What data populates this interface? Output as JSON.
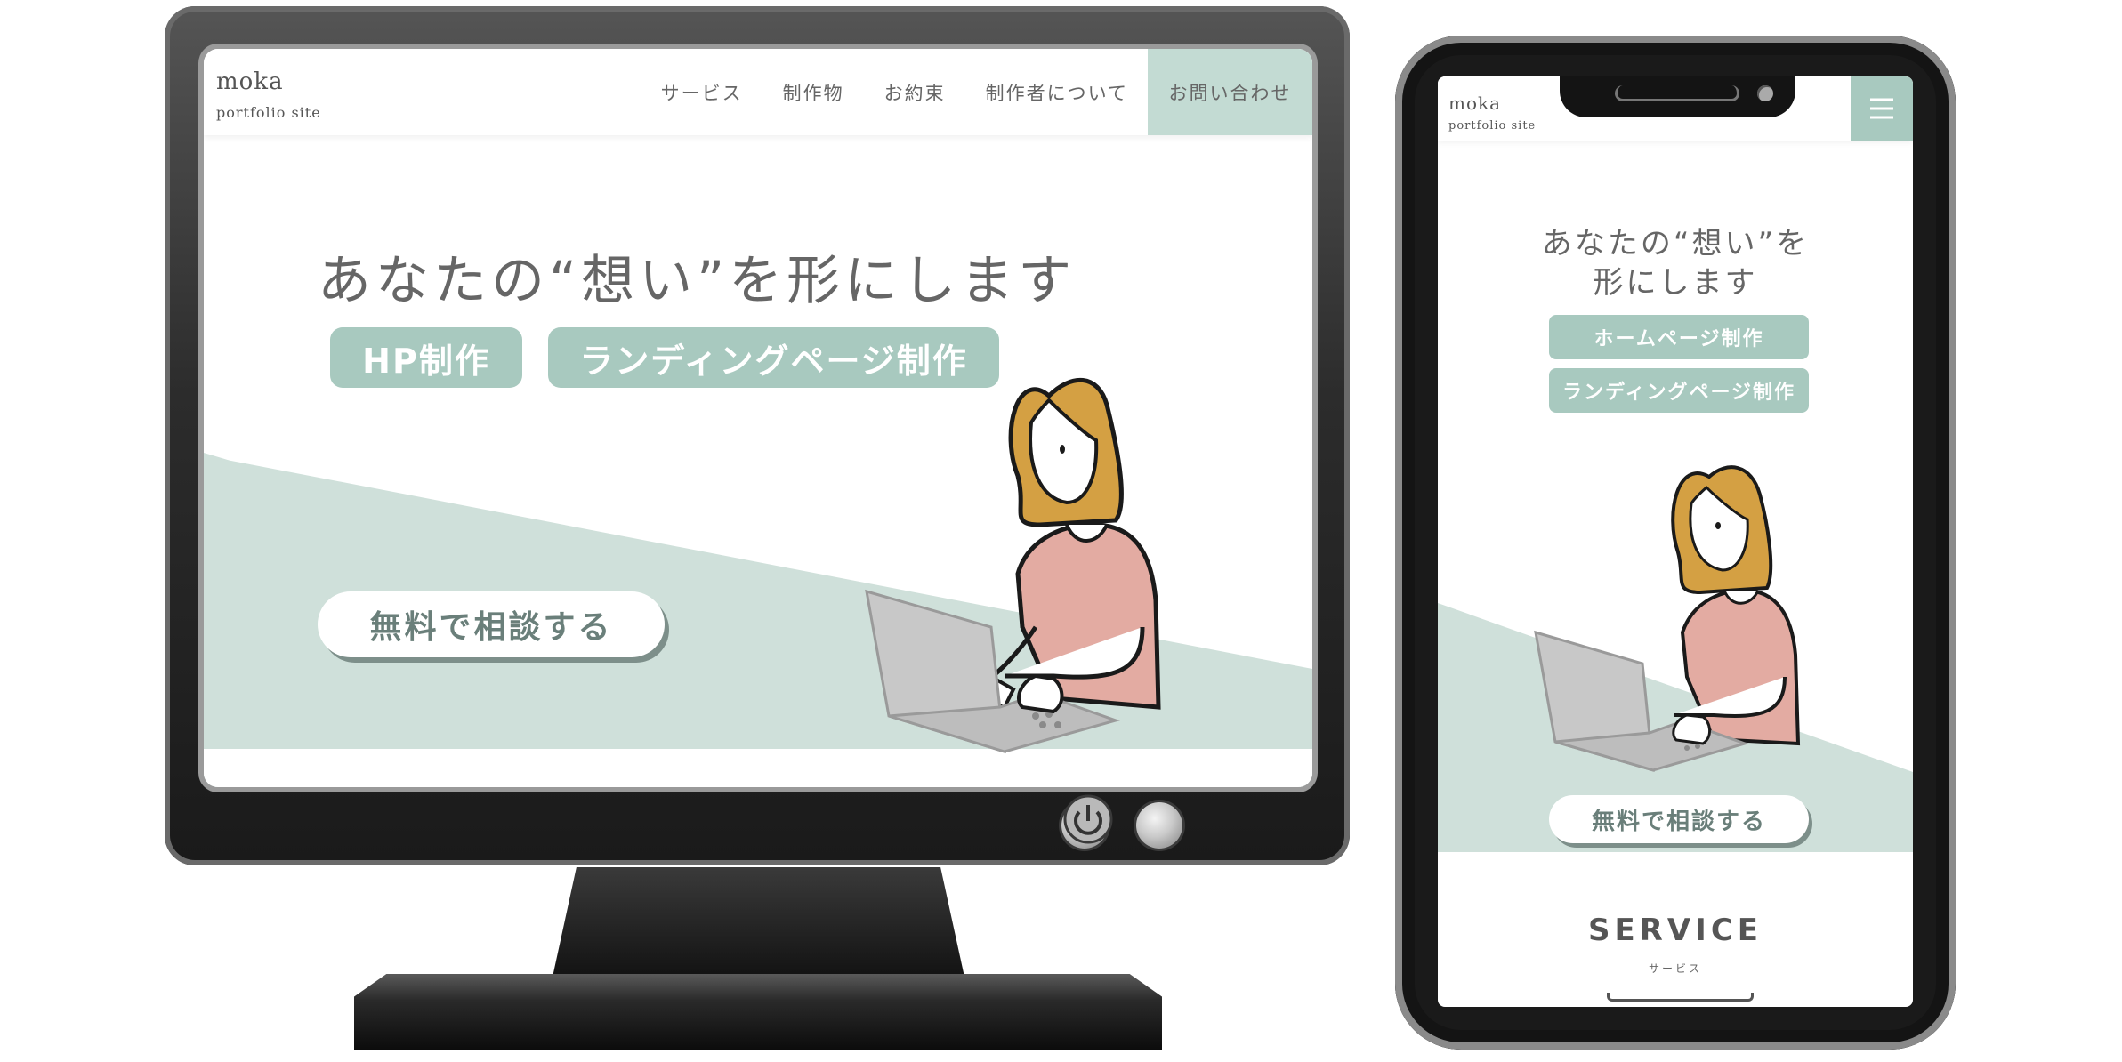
{
  "desktop": {
    "logo": "moka",
    "logo_sub": "portfolio site",
    "nav": [
      "サービス",
      "制作物",
      "お約束",
      "制作者について"
    ],
    "nav_contact": "お問い合わせ",
    "headline": "あなたの“想い”を形にします",
    "tags": [
      "HP制作",
      "ランディングページ制作"
    ],
    "cta": "無料で相談する"
  },
  "mobile": {
    "logo": "moka",
    "logo_sub": "portfolio site",
    "headline_line1": "あなたの“想い”を",
    "headline_line2": "形にします",
    "tags": [
      "ホームページ制作",
      "ランディングページ制作"
    ],
    "cta": "無料で相談する",
    "section_title": "SERVICE",
    "section_sub": "サービス"
  },
  "colors": {
    "accent": "#a8c9bf",
    "accent_light": "#c3dbd3",
    "hero_bg": "#cfe0da",
    "text": "#666666",
    "hair": "#d4a043",
    "shirt": "#e3aba2",
    "laptop": "#c8c8c8"
  },
  "icons": [
    "power-icon",
    "hamburger-menu-icon"
  ]
}
